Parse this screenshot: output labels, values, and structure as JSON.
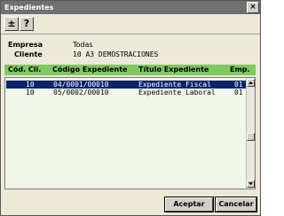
{
  "window": {
    "title": "Expedientes",
    "close_glyph": "×"
  },
  "toolbar": {
    "btn1": "±",
    "btn2": "?"
  },
  "fields": {
    "empresa_label": "Empresa",
    "empresa_value": "Todas",
    "cliente_label": "Cliente",
    "cliente_value": "10 A3 DEMOSTRACIONES"
  },
  "table": {
    "columns": [
      "Cód. Cli.",
      "Código Expediente",
      "Título Expediente",
      "Emp."
    ],
    "rows": [
      {
        "cod_cli": "10",
        "codigo": "04/0001/00010",
        "titulo": "Expediente Fiscal",
        "emp": "01",
        "selected": true
      },
      {
        "cod_cli": "10",
        "codigo": "05/0002/00010",
        "titulo": "Expediente Laboral",
        "emp": "01",
        "selected": false
      }
    ]
  },
  "buttons": {
    "accept": "Aceptar",
    "cancel": "Cancelar"
  },
  "colors": {
    "header_green": "#7fc95e",
    "selection": "#0a246a",
    "titlebar": "#707070"
  }
}
